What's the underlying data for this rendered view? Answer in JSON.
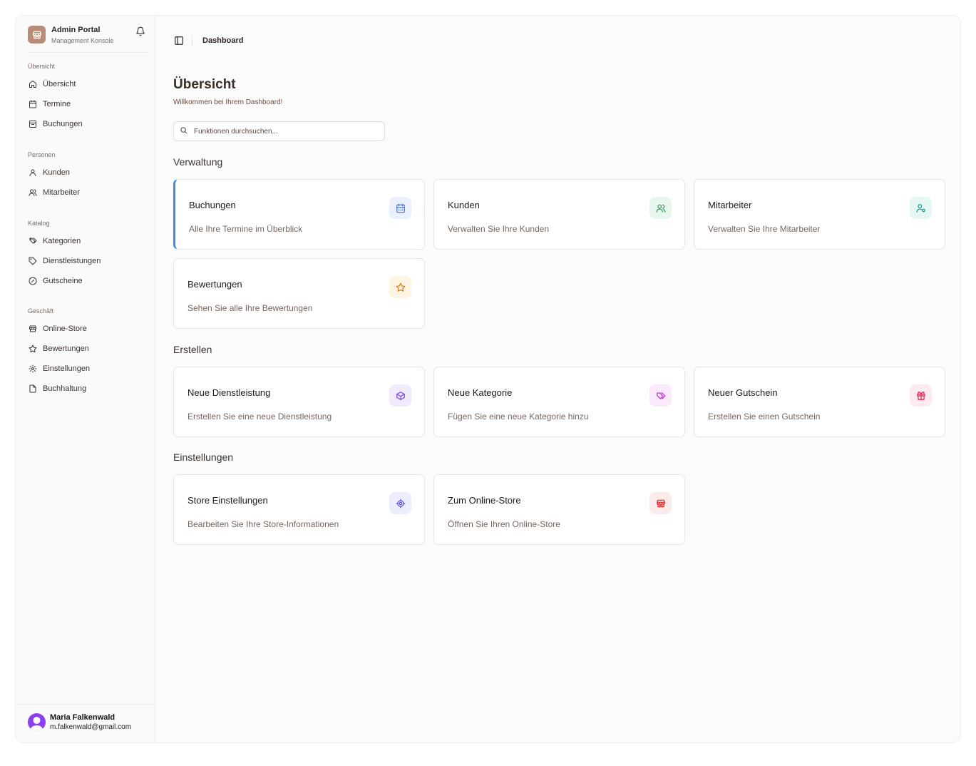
{
  "brand": {
    "title": "Admin Portal",
    "subtitle": "Management Konsole"
  },
  "sidebar": {
    "groups": [
      {
        "label": "Übersicht",
        "items": [
          {
            "label": "Übersicht",
            "icon": "home-icon"
          },
          {
            "label": "Termine",
            "icon": "calendar-icon"
          },
          {
            "label": "Buchungen",
            "icon": "booking-icon"
          }
        ]
      },
      {
        "label": "Personen",
        "items": [
          {
            "label": "Kunden",
            "icon": "user-icon"
          },
          {
            "label": "Mitarbeiter",
            "icon": "users-icon"
          }
        ]
      },
      {
        "label": "Katalog",
        "items": [
          {
            "label": "Kategorien",
            "icon": "tags-icon"
          },
          {
            "label": "Dienstleistungen",
            "icon": "tag-icon"
          },
          {
            "label": "Gutscheine",
            "icon": "badge-percent-icon"
          }
        ]
      },
      {
        "label": "Geschäft",
        "items": [
          {
            "label": "Online-Store",
            "icon": "store-icon"
          },
          {
            "label": "Bewertungen",
            "icon": "star-icon"
          },
          {
            "label": "Einstellungen",
            "icon": "settings-icon"
          },
          {
            "label": "Buchhaltung",
            "icon": "file-icon"
          }
        ]
      }
    ]
  },
  "user": {
    "name": "Maria Falkenwald",
    "email": "m.falkenwald@gmail.com"
  },
  "topbar": {
    "breadcrumb": "Dashboard"
  },
  "page": {
    "title": "Übersicht",
    "subtitle": "Willkommen bei Ihrem Dashboard!"
  },
  "search": {
    "placeholder": "Funktionen durchsuchen...",
    "value": ""
  },
  "sections": [
    {
      "title": "Verwaltung",
      "cards": [
        {
          "title": "Buchungen",
          "desc": "Alle Ihre Termine im Überblick",
          "icon": "calendar-icon",
          "color": "#3b6fd8",
          "bg": "#eaf1fd"
        },
        {
          "title": "Kunden",
          "desc": "Verwalten Sie Ihre Kunden",
          "icon": "users-icon",
          "color": "#16a34a",
          "bg": "#e8f7ee"
        },
        {
          "title": "Mitarbeiter",
          "desc": "Verwalten Sie Ihre Mitarbeiter",
          "icon": "user-cog-icon",
          "color": "#0d9488",
          "bg": "#e6f6f4"
        },
        {
          "title": "Bewertungen",
          "desc": "Sehen Sie alle Ihre Bewertungen",
          "icon": "star-icon",
          "color": "#d97706",
          "bg": "#fdf5e2"
        }
      ]
    },
    {
      "title": "Erstellen",
      "cards": [
        {
          "title": "Neue Dienstleistung",
          "desc": "Erstellen Sie eine neue Dienstleistung",
          "icon": "package-icon",
          "color": "#7c3aed",
          "bg": "#f1ebfd"
        },
        {
          "title": "Neue Kategorie",
          "desc": "Fügen Sie eine neue Kategorie hinzu",
          "icon": "tags-icon",
          "color": "#c026d3",
          "bg": "#fbeafd"
        },
        {
          "title": "Neuer Gutschein",
          "desc": "Erstellen Sie einen Gutschein",
          "icon": "gift-icon",
          "color": "#e11d48",
          "bg": "#fdeaee"
        }
      ]
    },
    {
      "title": "Einstellungen",
      "cards": [
        {
          "title": "Store Einstellungen",
          "desc": "Bearbeiten Sie Ihre Store-Informationen",
          "icon": "settings-icon",
          "color": "#4f46e5",
          "bg": "#eceefd"
        },
        {
          "title": "Zum Online-Store",
          "desc": "Öffnen Sie Ihren Online-Store",
          "icon": "store-icon",
          "color": "#dc2626",
          "bg": "#fdeaea"
        }
      ]
    }
  ]
}
